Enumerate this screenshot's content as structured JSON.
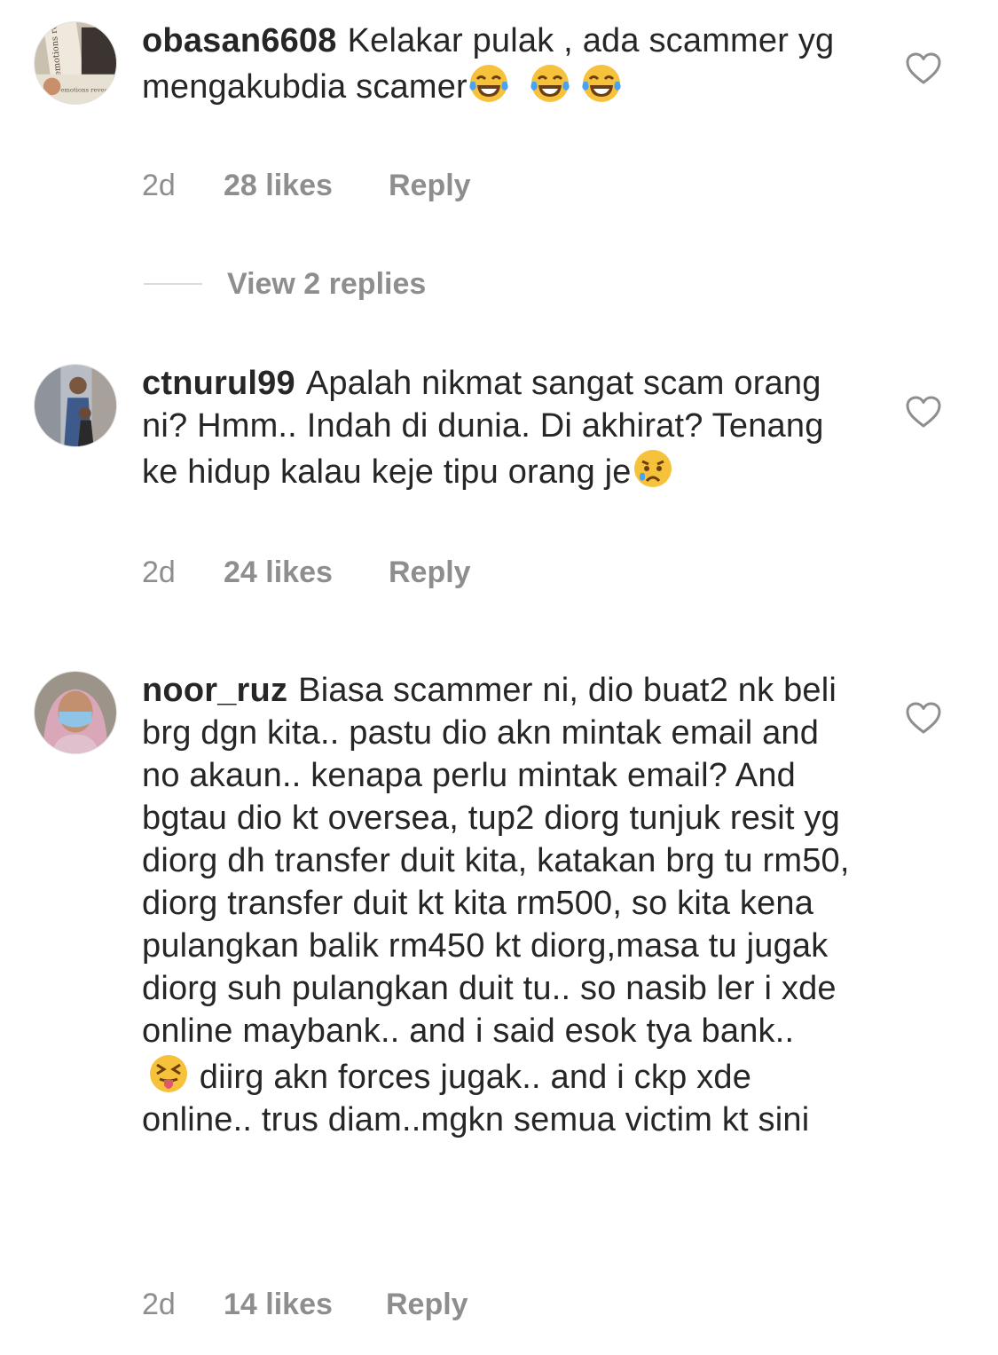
{
  "comments": [
    {
      "username": "obasan6608",
      "text": "Kelakar pulak , ada scammer yg mengakubdia scamer",
      "time": "2d",
      "likes": "28 likes",
      "reply": "Reply",
      "view_replies": "View 2 replies"
    },
    {
      "username": "ctnurul99",
      "text": "Apalah nikmat sangat scam orang ni?  Hmm.. Indah di dunia. Di akhirat? Tenang ke hidup kalau keje tipu orang je",
      "time": "2d",
      "likes": "24 likes",
      "reply": "Reply"
    },
    {
      "username": "noor_ruz",
      "text": "Biasa scammer ni, dio buat2 nk beli brg dgn kita.. pastu dio akn mintak email and no akaun.. kenapa perlu mintak email? And bgtau dio kt oversea, tup2 diorg tunjuk resit yg diorg dh transfer duit kita, katakan brg tu rm50, diorg transfer duit kt kita rm500, so kita kena pulangkan balik rm450 kt diorg,masa tu jugak diorg suh pulangkan duit tu.. so nasib ler i xde online maybank.. and i said esok tya bank..",
      "text_tail": "diirg akn forces jugak.. and i ckp xde online.. trus diam..mgkn semua victim kt sini",
      "time": "2d",
      "likes": "14 likes",
      "reply": "Reply"
    }
  ],
  "avatar_text": {
    "book_title": "emotions revealed",
    "book_title_short": "emotions revealed"
  },
  "icons": {
    "like": "heart-outline-icon",
    "laugh": "face-with-tears-of-joy-icon",
    "cry": "crying-face-icon",
    "tongue": "squinting-face-with-tongue-icon"
  }
}
